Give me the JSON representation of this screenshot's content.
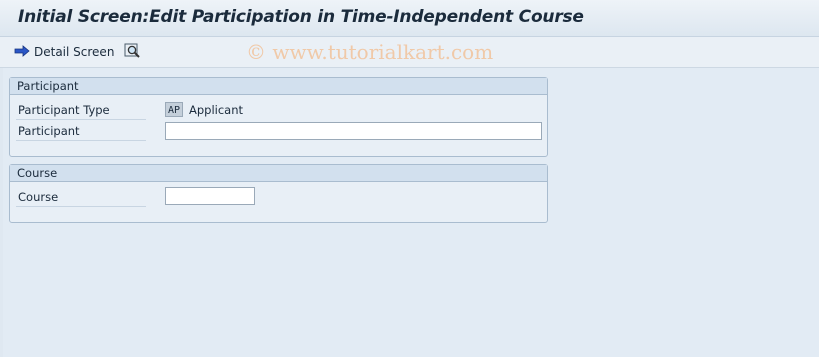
{
  "window": {
    "title": "Initial Screen:Edit Participation in Time-Independent Course"
  },
  "toolbar": {
    "detail_screen_label": "Detail Screen",
    "detail_icon": "arrow-right-icon",
    "second_icon": "magnifier-icon"
  },
  "watermark": "© www.tutorialkart.com",
  "participant_group": {
    "header": "Participant",
    "type_label": "Participant Type",
    "type_code": "AP",
    "type_value": "Applicant",
    "participant_label": "Participant",
    "participant_value": ""
  },
  "course_group": {
    "header": "Course",
    "course_label": "Course",
    "course_value": ""
  }
}
